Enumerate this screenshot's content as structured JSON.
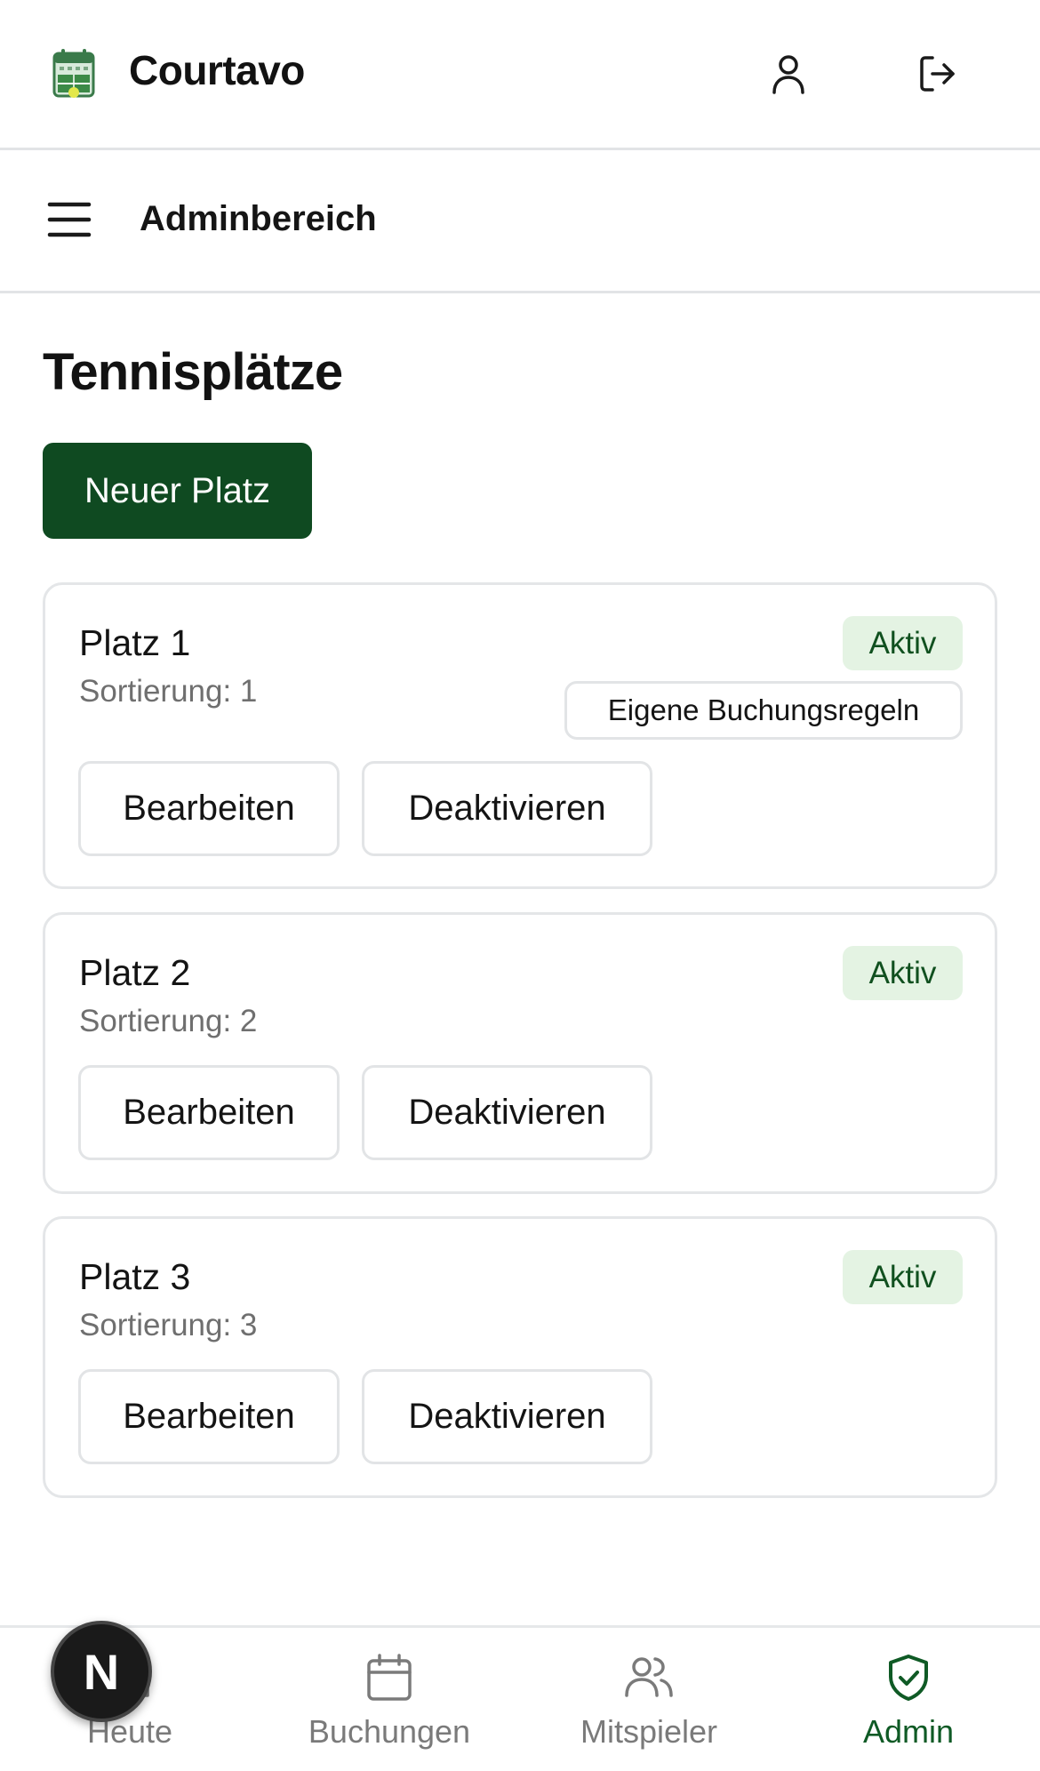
{
  "header": {
    "app_name": "Courtavo"
  },
  "subheader": {
    "title": "Adminbereich"
  },
  "main": {
    "title": "Tennisplätze",
    "new_button_label": "Neuer Platz",
    "courts": [
      {
        "name": "Platz 1",
        "sort": "Sortierung: 1",
        "status": "Aktiv",
        "rules_badge": "Eigene Buchungsregeln",
        "edit_label": "Bearbeiten",
        "deactivate_label": "Deaktivieren"
      },
      {
        "name": "Platz 2",
        "sort": "Sortierung: 2",
        "status": "Aktiv",
        "edit_label": "Bearbeiten",
        "deactivate_label": "Deaktivieren"
      },
      {
        "name": "Platz 3",
        "sort": "Sortierung: 3",
        "status": "Aktiv",
        "edit_label": "Bearbeiten",
        "deactivate_label": "Deaktivieren"
      }
    ]
  },
  "bottom_nav": {
    "items": [
      {
        "label": "Heute",
        "icon": "home-icon",
        "active": false
      },
      {
        "label": "Buchungen",
        "icon": "calendar-icon",
        "active": false
      },
      {
        "label": "Mitspieler",
        "icon": "users-icon",
        "active": false
      },
      {
        "label": "Admin",
        "icon": "shield-check-icon",
        "active": true
      }
    ]
  },
  "dev_badge": {
    "letter": "N"
  },
  "colors": {
    "primary": "#0f4a21",
    "badge_bg": "#e4f3e3",
    "badge_text": "#10501f",
    "muted_text": "#6f6f6f",
    "nav_inactive": "#7a7a7a",
    "nav_active": "#0f5a25"
  }
}
